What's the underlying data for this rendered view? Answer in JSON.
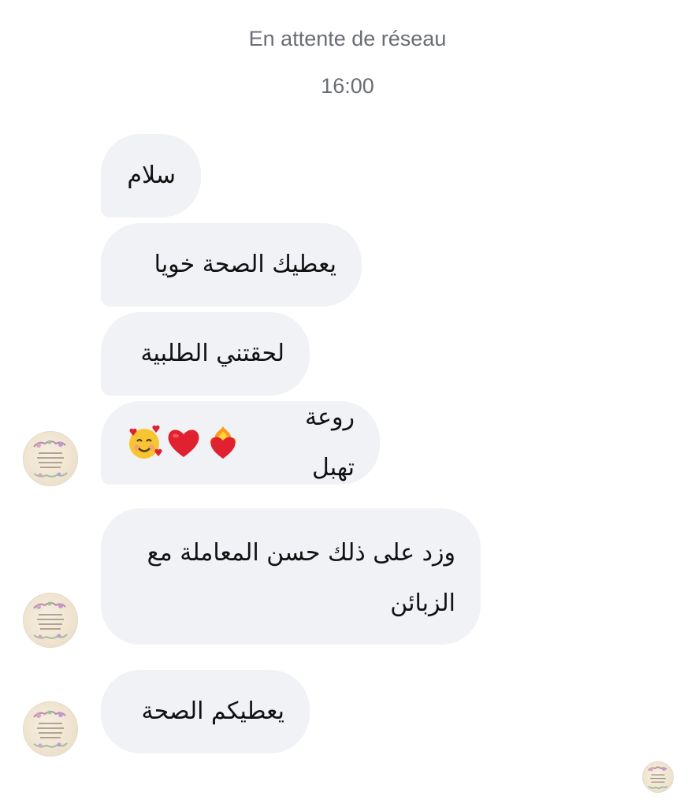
{
  "header": {
    "network_status": "En attente de réseau",
    "timestamp": "16:00"
  },
  "messages": [
    {
      "text": "سلام"
    },
    {
      "text": "يعطيك الصحة خويا"
    },
    {
      "text": "لحقتني الطلبية"
    },
    {
      "text": "روعة تهبل",
      "emojis": [
        "heart-on-fire-icon",
        "red-heart-icon",
        "smiling-face-with-hearts-icon"
      ]
    },
    {
      "text": "وزد على ذلك حسن المعاملة مع\nالزبائن"
    },
    {
      "text": "يعطيكم الصحة"
    }
  ],
  "colors": {
    "bubble_bg": "#f1f2f6",
    "status_text": "#6a6d72",
    "message_text": "#111111",
    "heart_red": "#e0212f"
  }
}
